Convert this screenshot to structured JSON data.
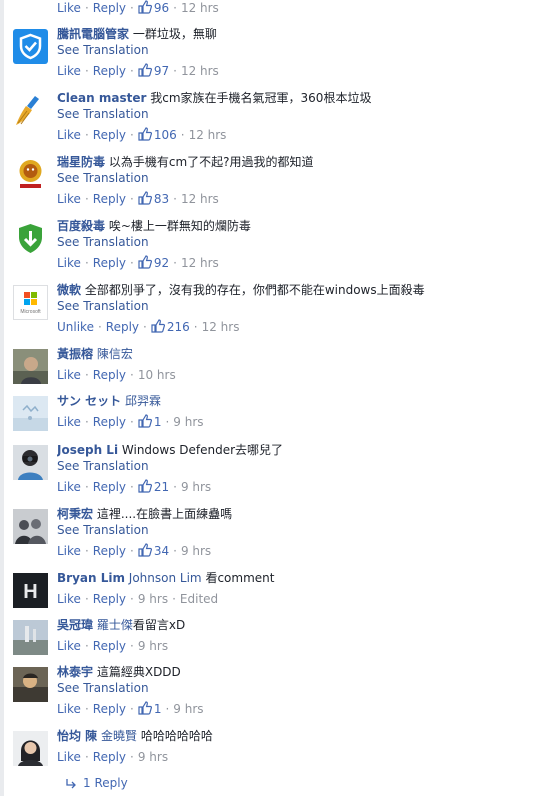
{
  "top_actions": {
    "like": "Like",
    "reply": "Reply",
    "likes": "96",
    "time": "12 hrs"
  },
  "comments": [
    {
      "author": "騰訊電腦管家",
      "text": "一群垃圾，無聊",
      "translate": "See Translation",
      "like": "Like",
      "reply": "Reply",
      "likes": "97",
      "time": "12 hrs",
      "avatar": "tencent-shield-icon"
    },
    {
      "author": "Clean master",
      "text": "我cm家族在手機名氣冠軍，360根本垃圾",
      "translate": "See Translation",
      "like": "Like",
      "reply": "Reply",
      "likes": "106",
      "time": "12 hrs",
      "avatar": "broom-icon"
    },
    {
      "author": "瑞星防毒",
      "text": "以為手機有cm了不起?用過我的都知道",
      "translate": "See Translation",
      "like": "Like",
      "reply": "Reply",
      "likes": "83",
      "time": "12 hrs",
      "avatar": "lion-icon"
    },
    {
      "author": "百度殺毒",
      "text": "唉~樓上一群無知的爛防毒",
      "translate": "See Translation",
      "like": "Like",
      "reply": "Reply",
      "likes": "92",
      "time": "12 hrs",
      "avatar": "baidu-shield-icon"
    },
    {
      "author": "微軟",
      "text": "全部都別爭了，沒有我的存在，你們都不能在windows上面殺毒",
      "translate": "See Translation",
      "like": "Unlike",
      "reply": "Reply",
      "likes": "216",
      "time": "12 hrs",
      "avatar": "microsoft-logo-icon",
      "avatar_text": "Microsoft"
    },
    {
      "author": "黃振榕",
      "tag": "陳信宏",
      "like": "Like",
      "reply": "Reply",
      "time": "10 hrs",
      "avatar": "user-photo"
    },
    {
      "author": "サン セット",
      "tag": "邱羿霖",
      "like": "Like",
      "reply": "Reply",
      "likes": "1",
      "time": "9 hrs",
      "avatar": "user-photo"
    },
    {
      "author": "Joseph Li",
      "text": "Windows Defender去哪兒了",
      "translate": "See Translation",
      "like": "Like",
      "reply": "Reply",
      "likes": "21",
      "time": "9 hrs",
      "avatar": "user-photo"
    },
    {
      "author": "柯秉宏",
      "text": "這裡....在臉書上面練蠱嗎",
      "translate": "See Translation",
      "like": "Like",
      "reply": "Reply",
      "likes": "34",
      "time": "9 hrs",
      "avatar": "user-photo"
    },
    {
      "author": "Bryan Lim",
      "tag": "Johnson Lim",
      "text": "看comment",
      "like": "Like",
      "reply": "Reply",
      "time": "9 hrs",
      "edited": "Edited",
      "avatar": "h-letter-icon",
      "avatar_text": "H"
    },
    {
      "author": "吳冠瑋",
      "tag": "羅士傑",
      "text": "看留言xD",
      "like": "Like",
      "reply": "Reply",
      "time": "9 hrs",
      "avatar": "user-photo"
    },
    {
      "author": "林泰宇",
      "text": "這篇經典XDDD",
      "translate": "See Translation",
      "like": "Like",
      "reply": "Reply",
      "likes": "1",
      "time": "9 hrs",
      "avatar": "user-photo"
    },
    {
      "author": "怡均 陳",
      "tag": "金曉賢",
      "text": "哈哈哈哈哈哈",
      "like": "Like",
      "reply": "Reply",
      "time": "9 hrs",
      "avatar": "user-photo"
    }
  ],
  "replies_link": "1 Reply",
  "colors": {
    "link": "#365899",
    "action": "#4267b2",
    "meta": "#90949c",
    "text": "#1d2129"
  }
}
